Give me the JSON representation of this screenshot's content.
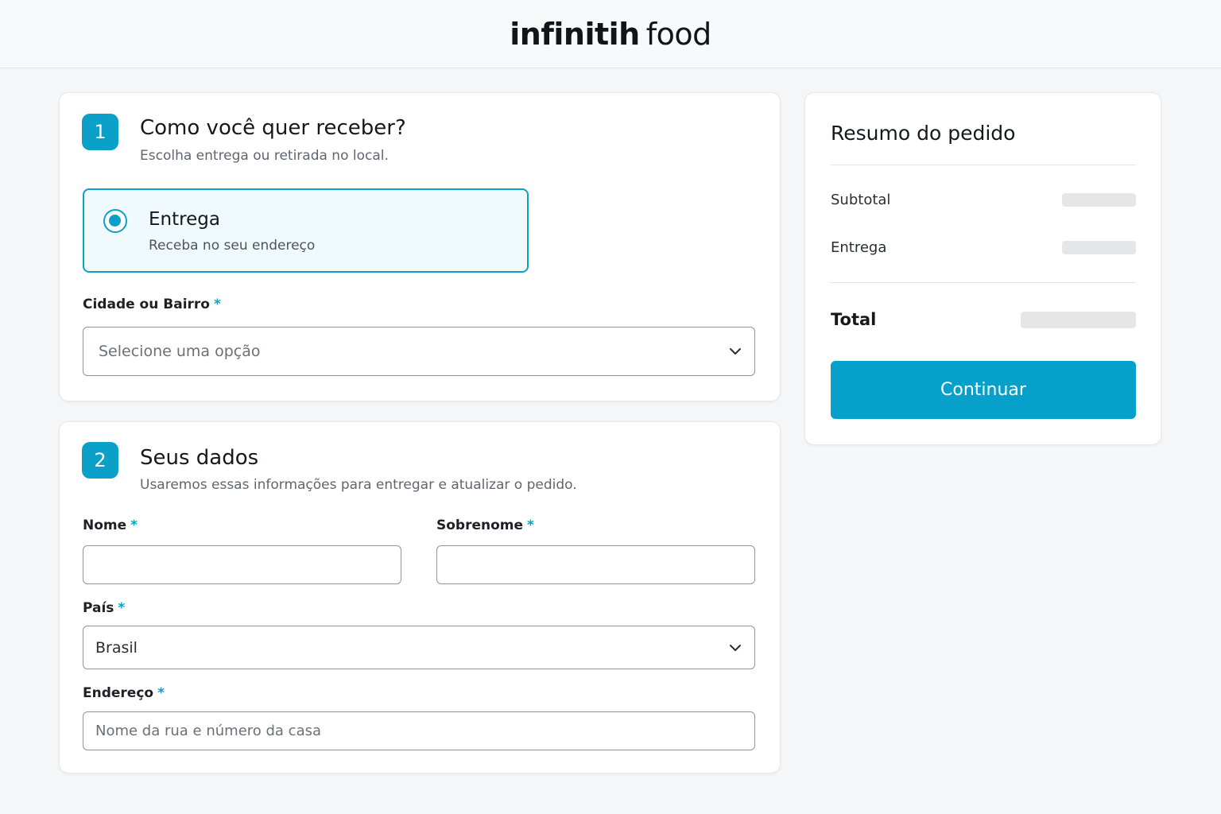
{
  "header": {
    "logo_bold": "infinitih",
    "logo_light": "food"
  },
  "delivery_section": {
    "step": "1",
    "title": "Como você quer receber?",
    "subtitle": "Escolha entrega ou retirada no local.",
    "option": {
      "title": "Entrega",
      "subtitle": "Receba no seu endereço",
      "selected": true
    },
    "city_field": {
      "label": "Cidade ou Bairro",
      "required_mark": "*",
      "placeholder": "Selecione uma opção"
    }
  },
  "personal_section": {
    "step": "2",
    "title": "Seus dados",
    "subtitle": "Usaremos essas informações para entregar e atualizar o pedido.",
    "first_name": {
      "label": "Nome",
      "required_mark": "*",
      "value": ""
    },
    "last_name": {
      "label": "Sobrenome",
      "required_mark": "*",
      "value": ""
    },
    "country": {
      "label": "País",
      "required_mark": "*",
      "value": "Brasil"
    },
    "address": {
      "label": "Endereço",
      "required_mark": "*",
      "placeholder": "Nome da rua e número da casa"
    }
  },
  "summary": {
    "title": "Resumo do pedido",
    "subtotal_label": "Subtotal",
    "delivery_label": "Entrega",
    "total_label": "Total",
    "continue_label": "Continuar"
  },
  "colors": {
    "accent": "#0aa0c8",
    "button": "#06a0cb",
    "background": "#f5f6f7"
  },
  "icons": {
    "dropdown": "chevron-down-icon",
    "radio": "radio-selected-icon"
  }
}
